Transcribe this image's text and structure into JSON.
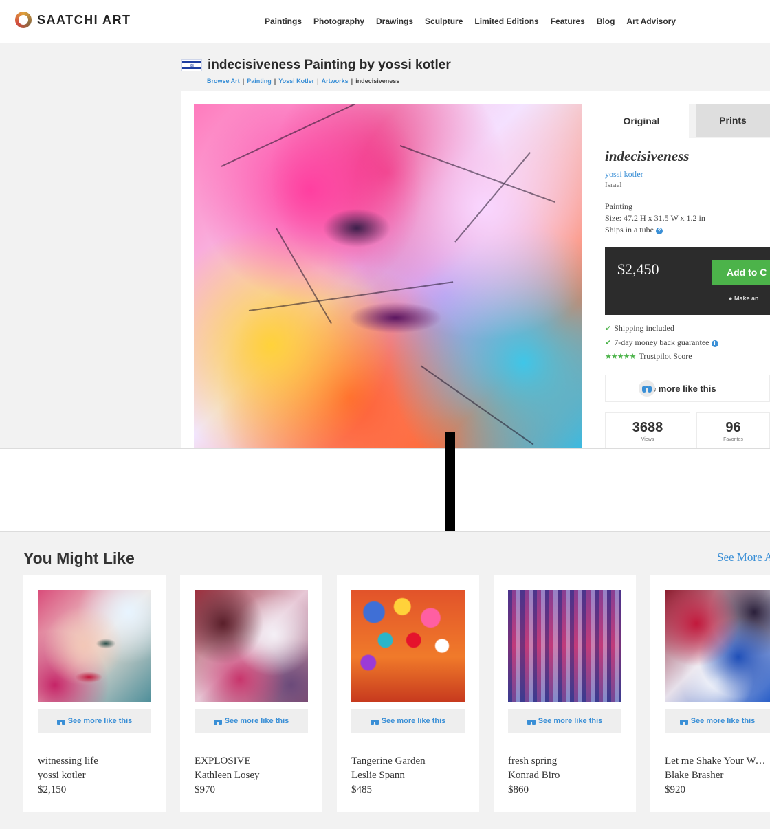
{
  "header": {
    "logo_text": "SAATCHI ART",
    "nav": [
      "Paintings",
      "Photography",
      "Drawings",
      "Sculpture",
      "Limited Editions",
      "Features",
      "Blog",
      "Art Advisory"
    ]
  },
  "page": {
    "title": "indecisiveness Painting by yossi kotler",
    "breadcrumbs": [
      "Browse Art",
      "Painting",
      "Yossi Kotler",
      "Artworks",
      "indecisiveness"
    ]
  },
  "product": {
    "tabs": {
      "original": "Original",
      "prints": "Prints"
    },
    "title": "indecisiveness",
    "artist": "yossi kotler",
    "country": "Israel",
    "medium": "Painting",
    "size": "Size: 47.2 H x 31.5 W x 1.2 in",
    "shipping": "Ships in a tube",
    "price": "$2,450",
    "add_to_cart": "Add to C",
    "make_offer": "Make an",
    "perks": {
      "shipping": "Shipping included",
      "guarantee": "7-day money back guarantee",
      "trustpilot": "Trustpilot Score"
    },
    "see_more": "See more like this",
    "stats": {
      "views": "3688",
      "views_label": "Views",
      "favorites": "96",
      "favorites_label": "Favorites"
    }
  },
  "recommendations": {
    "title": "You Might Like",
    "see_more_all": "See More A",
    "see_more_label": "See more like this",
    "items": [
      {
        "title": "witnessing life",
        "artist": "yossi kotler",
        "price": "$2,150"
      },
      {
        "title": "EXPLOSIVE",
        "artist": "Kathleen Losey",
        "price": "$970"
      },
      {
        "title": "Tangerine Garden",
        "artist": "Leslie Spann",
        "price": "$485"
      },
      {
        "title": "fresh spring",
        "artist": "Konrad Biro",
        "price": "$860"
      },
      {
        "title": "Let me Shake Your World",
        "artist": "Blake Brasher",
        "price": "$920"
      }
    ]
  },
  "colors": {
    "link_blue": "#3a8fd6",
    "buy_green": "#4cb34a",
    "price_box": "#2c2c2c"
  },
  "icons": [
    "logo-ring-icon",
    "israel-flag-icon",
    "binoculars-icon",
    "check-icon",
    "star-icon",
    "info-icon",
    "chat-icon"
  ]
}
